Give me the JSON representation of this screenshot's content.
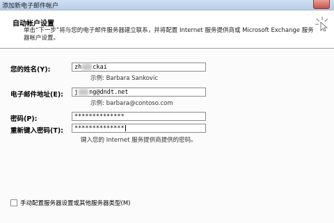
{
  "window": {
    "title": "添加新电子邮件帐户"
  },
  "header": {
    "title": "自动帐户设置",
    "description": "单击“下一步”将与您的电子邮件服务器建立联系，并将配置 Internet 服务提供商或 Microsoft Exchange 服务器帐户设置。",
    "icon": "cursor-sparkle-icon"
  },
  "form": {
    "name": {
      "label": "您的姓名(Y):",
      "value_start": "zh",
      "value_end": "ckai",
      "hint": "示例: Barbara Sankovic"
    },
    "email": {
      "label": "电子邮件地址(E):",
      "value_start": "j",
      "value_end": "ng@dndt.net",
      "hint": "示例: barbara@contoso.com"
    },
    "password": {
      "label": "密码(P):",
      "value": "**************"
    },
    "confirm_password": {
      "label": "重新键入密码(T):",
      "value": "**************"
    },
    "password_hint": "键入您的 Internet 服务提供商提供的密码。"
  },
  "manual_config": {
    "label": "手动配置服务器设置或其他服务器类型(M)",
    "checked": false
  }
}
